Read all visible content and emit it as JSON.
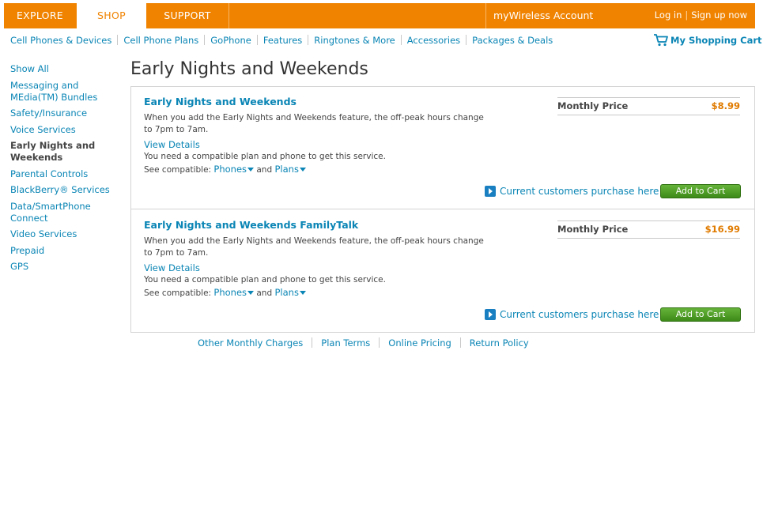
{
  "topnav": {
    "tabs": [
      {
        "label": "EXPLORE"
      },
      {
        "label": "SHOP"
      },
      {
        "label": "SUPPORT"
      }
    ],
    "account": "myWireless Account",
    "login": "Log in",
    "signup": "Sign up now"
  },
  "subnav": {
    "items": [
      "Cell Phones & Devices",
      "Cell Phone Plans",
      "GoPhone",
      "Features",
      "Ringtones & More",
      "Accessories",
      "Packages & Deals"
    ],
    "cart": "My Shopping Cart"
  },
  "sidebar": {
    "items": [
      "Show All",
      "Messaging and MEdia(TM) Bundles",
      "Safety/Insurance",
      "Voice Services",
      "Early Nights and Weekends",
      "Parental Controls",
      "BlackBerry® Services",
      "Data/SmartPhone Connect",
      "Video Services",
      "Prepaid",
      "GPS"
    ],
    "active_index": 4
  },
  "page_title": "Early Nights and Weekends",
  "products": [
    {
      "title": "Early Nights and Weekends",
      "description": "When you add the Early Nights and Weekends feature, the off-peak hours change to 7pm to 7am.",
      "details_link": "View Details",
      "requirement": "You need a compatible plan and phone to get this service.",
      "compat_prefix": "See compatible:",
      "compat_phones": "Phones",
      "compat_and": "and",
      "compat_plans": "Plans",
      "price_label": "Monthly Price",
      "price": "$8.99",
      "purchase_link": "Current customers purchase here",
      "add_button": "Add to Cart"
    },
    {
      "title": "Early Nights and Weekends FamilyTalk",
      "description": "When you add the Early Nights and Weekends feature, the off-peak hours change to 7pm to 7am.",
      "details_link": "View Details",
      "requirement": "You need a compatible plan and phone to get this service.",
      "compat_prefix": "See compatible:",
      "compat_phones": "Phones",
      "compat_and": "and",
      "compat_plans": "Plans",
      "price_label": "Monthly Price",
      "price": "$16.99",
      "purchase_link": "Current customers purchase here",
      "add_button": "Add to Cart"
    }
  ],
  "footer": {
    "links": [
      "Other Monthly Charges",
      "Plan Terms",
      "Online Pricing",
      "Return Policy"
    ]
  },
  "colors": {
    "brand_orange": "#f08300",
    "link_blue": "#0a85b5",
    "price_orange": "#e07b00",
    "button_green": "#4f9e28"
  }
}
